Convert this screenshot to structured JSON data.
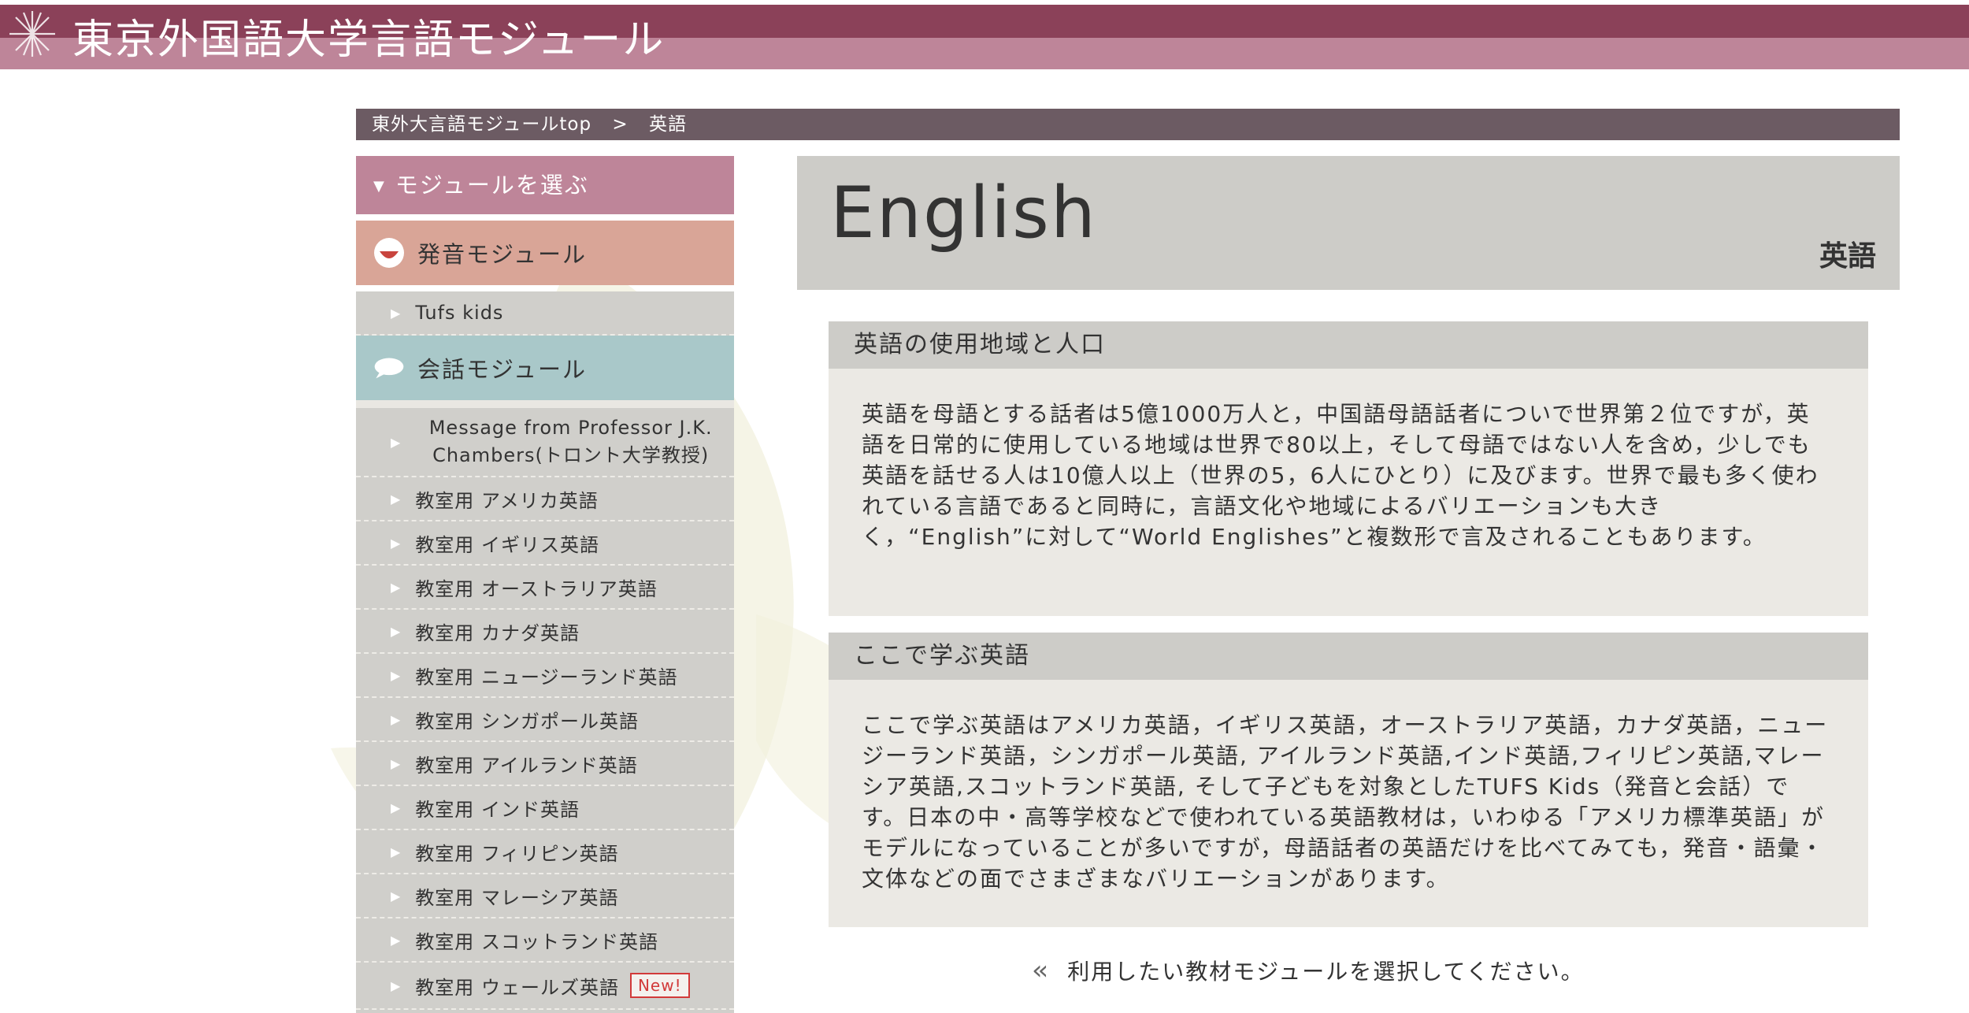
{
  "header": {
    "title": "東京外国語大学言語モジュール",
    "logo_icon": "starburst-icon"
  },
  "breadcrumb": {
    "home": "東外大言語モジュールtop",
    "separator": ">",
    "current": "英語"
  },
  "sidebar": {
    "heading": "モジュールを選ぶ",
    "pronunciation": {
      "label": "発音モジュール",
      "icon": "mouth-icon",
      "items": [
        "Tufs kids"
      ]
    },
    "conversation": {
      "label": "会話モジュール",
      "icon": "speech-bubble-icon",
      "items": [
        "Message from Professor J.K. Chambers(トロント大学教授)",
        "教室用 アメリカ英語",
        "教室用 イギリス英語",
        "教室用 オーストラリア英語",
        "教室用 カナダ英語",
        "教室用 ニュージーランド英語",
        "教室用 シンガポール英語",
        "教室用 アイルランド英語",
        "教室用 インド英語",
        "教室用 フィリピン英語",
        "教室用 マレーシア英語",
        "教室用 スコットランド英語",
        "教室用 ウェールズ英語"
      ],
      "new_badge": "New!"
    }
  },
  "main": {
    "title": "English",
    "subtitle": "英語",
    "sections": [
      {
        "heading": "英語の使用地域と人口",
        "body": "英語を母語とする話者は5億1000万人と，中国語母語話者についで世界第２位ですが，英語を日常的に使用している地域は世界で80以上，そして母語ではない人を含め，少しでも英語を話せる人は10億人以上（世界の5，6人にひとり）に及びます。世界で最も多く使われている言語であると同時に，言語文化や地域によるバリエーションも大きく，“English”に対して“World Englishes”と複数形で言及されることもあります。"
      },
      {
        "heading": "ここで学ぶ英語",
        "body": "ここで学ぶ英語はアメリカ英語，イギリス英語，オーストラリア英語，カナダ英語，ニュージーランド英語，シンガポール英語, アイルランド英語,インド英語,フィリピン英語,マレーシア英語,スコットランド英語, そして子どもを対象としたTUFS Kids（発音と会話）です。日本の中・高等学校などで使われている英語教材は，いわゆる「アメリカ標準英語」がモデルになっていることが多いですが，母語話者の英語だけを比べてみても，発音・語彙・文体などの面でさまざまなバリエーションがあります。"
      }
    ],
    "prompt": "利用したい教材モジュールを選択してください。",
    "prompt_icon": "double-chevron-left-icon"
  },
  "colors": {
    "header": "#8b4159",
    "header_band": "#be8599",
    "breadcrumb": "#6c5b63",
    "pronunciation": "#d9a597",
    "conversation": "#a9c8c9",
    "item_bg": "#d0cfcb",
    "card_bg": "#ebe9e4",
    "badge": "#d23a3a"
  }
}
